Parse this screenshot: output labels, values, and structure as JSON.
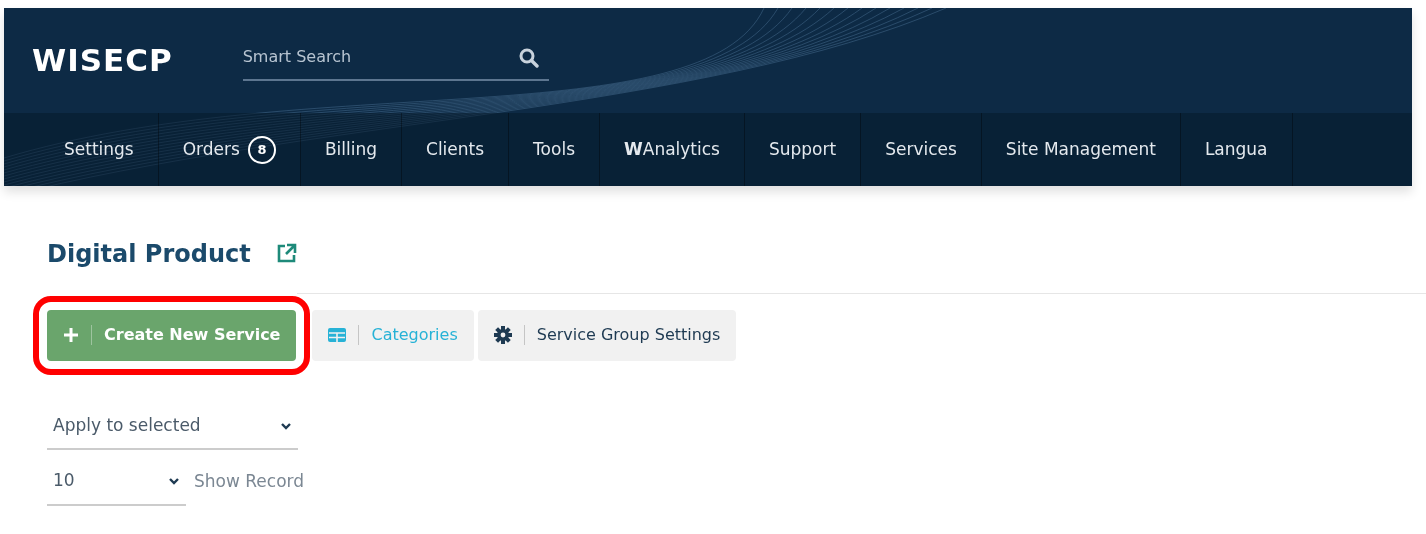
{
  "header": {
    "logo": "WISECP",
    "search": {
      "placeholder": "Smart Search"
    }
  },
  "nav": [
    {
      "label": "Settings"
    },
    {
      "label": "Orders",
      "count": "8"
    },
    {
      "label": "Billing"
    },
    {
      "label": "Clients"
    },
    {
      "label": "Tools"
    },
    {
      "label": "**W**Analytics"
    },
    {
      "label": "Support"
    },
    {
      "label": "Services"
    },
    {
      "label": "Site Management"
    },
    {
      "label": "Langua"
    }
  ],
  "page": {
    "title": "Digital Product"
  },
  "actions": [
    {
      "kind": "primary",
      "label": "Create New Service",
      "highlighted": true
    },
    {
      "kind": "link",
      "label": "Categories",
      "highlighted": false
    },
    {
      "kind": "plain",
      "label": "Service Group Settings",
      "highlighted": false
    }
  ],
  "bulk_select": {
    "value": "Apply to selected"
  },
  "page_size": {
    "value": "10",
    "label": "Show Record"
  }
}
